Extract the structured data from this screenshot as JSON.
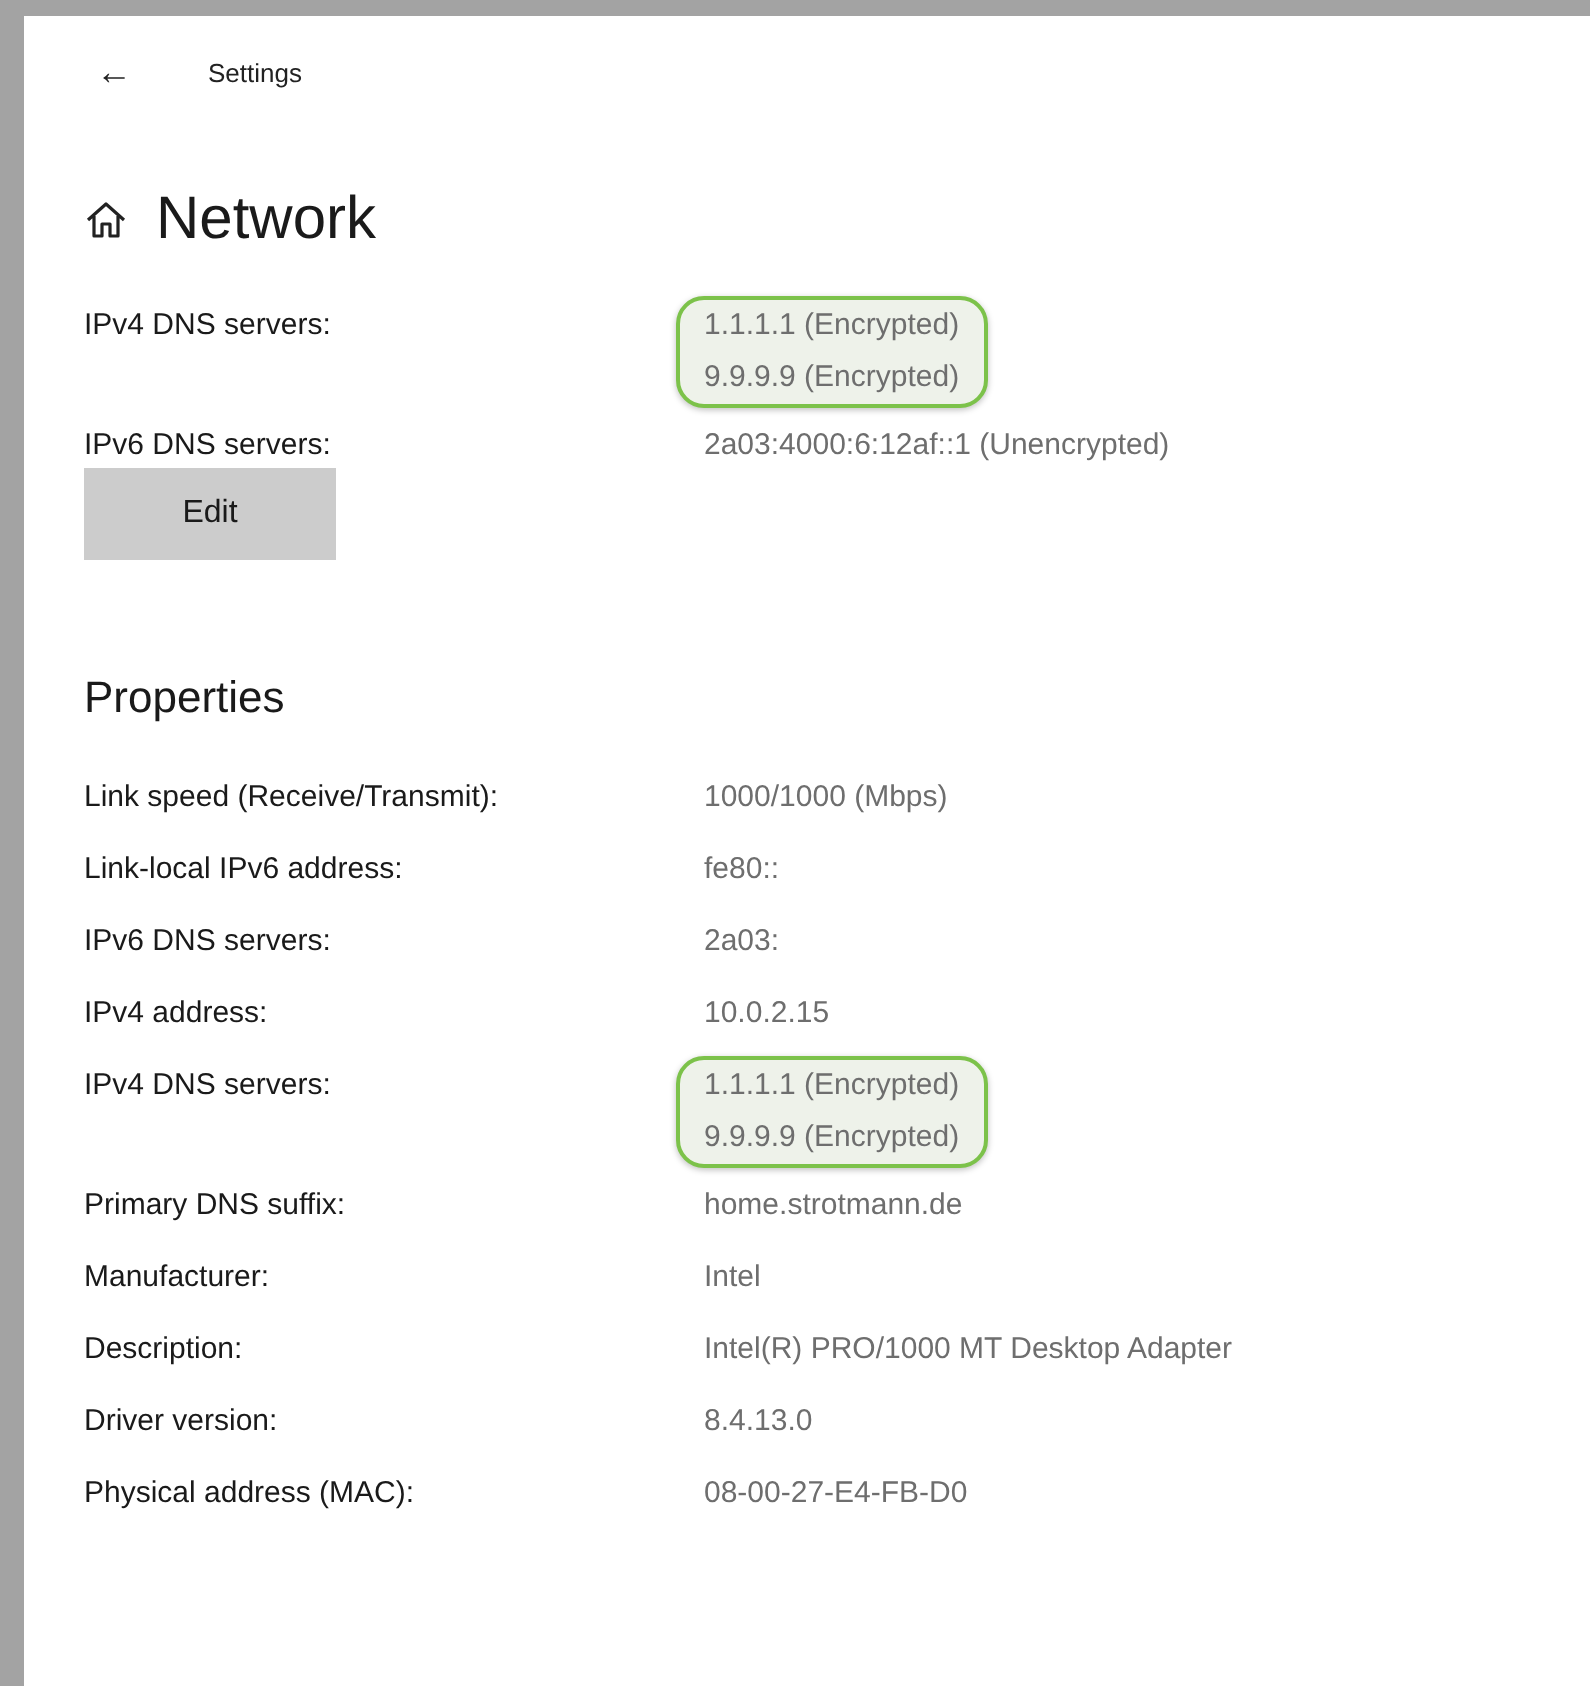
{
  "header": {
    "back_glyph": "←",
    "title": "Settings"
  },
  "page_title": "Network",
  "dns_rows": [
    {
      "label": "IPv4 DNS servers:",
      "values": [
        "1.1.1.1 (Encrypted)",
        "9.9.9.9 (Encrypted)"
      ],
      "highlighted": true
    },
    {
      "label": "IPv6 DNS servers:",
      "values": [
        "2a03:4000:6:12af::1 (Unencrypted)"
      ],
      "highlighted": false
    }
  ],
  "edit_button": "Edit",
  "properties": {
    "heading": "Properties",
    "rows": [
      {
        "label": "Link speed (Receive/Transmit):",
        "values": [
          "1000/1000 (Mbps)"
        ],
        "highlighted": false
      },
      {
        "label": "Link-local IPv6 address:",
        "values": [
          "fe80::"
        ],
        "highlighted": false
      },
      {
        "label": "IPv6 DNS servers:",
        "values": [
          "2a03:"
        ],
        "highlighted": false
      },
      {
        "label": "IPv4 address:",
        "values": [
          "10.0.2.15"
        ],
        "highlighted": false
      },
      {
        "label": "IPv4 DNS servers:",
        "values": [
          "1.1.1.1 (Encrypted)",
          "9.9.9.9 (Encrypted)"
        ],
        "highlighted": true
      },
      {
        "label": "Primary DNS suffix:",
        "values": [
          "home.strotmann.de"
        ],
        "highlighted": false
      },
      {
        "label": "Manufacturer:",
        "values": [
          "Intel"
        ],
        "highlighted": false
      },
      {
        "label": "Description:",
        "values": [
          "Intel(R) PRO/1000 MT Desktop Adapter"
        ],
        "highlighted": false
      },
      {
        "label": "Driver version:",
        "values": [
          "8.4.13.0"
        ],
        "highlighted": false
      },
      {
        "label": "Physical address (MAC):",
        "values": [
          "08-00-27-E4-FB-D0"
        ],
        "highlighted": false
      }
    ]
  }
}
